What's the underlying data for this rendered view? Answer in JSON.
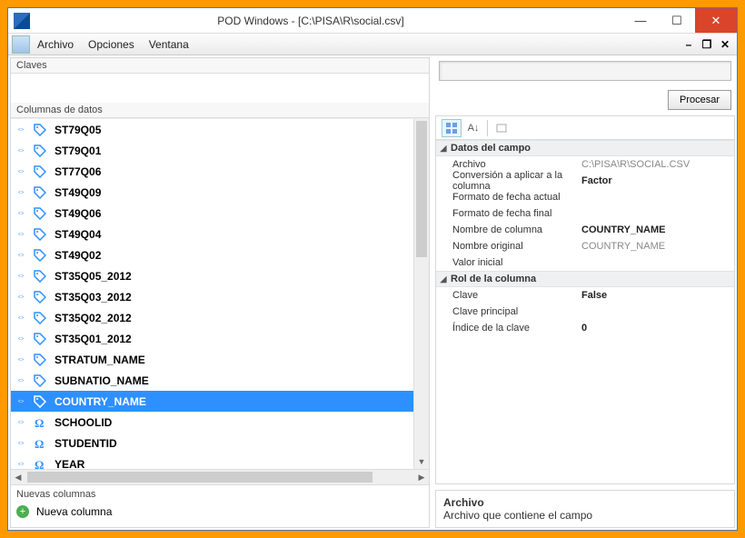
{
  "window": {
    "title": "POD Windows - [C:\\PISA\\R\\social.csv]"
  },
  "menubar": [
    "Archivo",
    "Opciones",
    "Ventana"
  ],
  "left": {
    "claves_label": "Claves",
    "columns_label": "Columnas de datos",
    "items": [
      {
        "name": "YEAR",
        "icon": "omega"
      },
      {
        "name": "STUDENTID",
        "icon": "omega"
      },
      {
        "name": "SCHOOLID",
        "icon": "omega"
      },
      {
        "name": "COUNTRY_NAME",
        "icon": "tag",
        "selected": true
      },
      {
        "name": "SUBNATIO_NAME",
        "icon": "tag"
      },
      {
        "name": "STRATUM_NAME",
        "icon": "tag"
      },
      {
        "name": "ST35Q01_2012",
        "icon": "tag"
      },
      {
        "name": "ST35Q02_2012",
        "icon": "tag"
      },
      {
        "name": "ST35Q03_2012",
        "icon": "tag"
      },
      {
        "name": "ST35Q05_2012",
        "icon": "tag"
      },
      {
        "name": "ST49Q02",
        "icon": "tag"
      },
      {
        "name": "ST49Q04",
        "icon": "tag"
      },
      {
        "name": "ST49Q06",
        "icon": "tag"
      },
      {
        "name": "ST49Q09",
        "icon": "tag"
      },
      {
        "name": "ST77Q06",
        "icon": "tag"
      },
      {
        "name": "ST79Q01",
        "icon": "tag"
      },
      {
        "name": "ST79Q05",
        "icon": "tag"
      }
    ],
    "new_label": "Nuevas columnas",
    "new_item": "Nueva columna"
  },
  "right": {
    "procesar": "Procesar",
    "cat1": "Datos del campo",
    "rows1": [
      {
        "k": "Archivo",
        "v": "C:\\PISA\\R\\SOCIAL.CSV",
        "gray": true
      },
      {
        "k": "Conversión a aplicar a la columna",
        "v": "Factor"
      },
      {
        "k": "Formato de fecha actual",
        "v": ""
      },
      {
        "k": "Formato de fecha final",
        "v": ""
      },
      {
        "k": "Nombre de columna",
        "v": "COUNTRY_NAME"
      },
      {
        "k": "Nombre original",
        "v": "COUNTRY_NAME",
        "gray": true
      },
      {
        "k": "Valor inicial",
        "v": ""
      }
    ],
    "cat2": "Rol de la columna",
    "rows2": [
      {
        "k": "Clave",
        "v": "False"
      },
      {
        "k": "Clave principal",
        "v": ""
      },
      {
        "k": "Índice de la clave",
        "v": "0"
      }
    ],
    "desc_title": "Archivo",
    "desc_text": "Archivo que contiene el campo"
  }
}
